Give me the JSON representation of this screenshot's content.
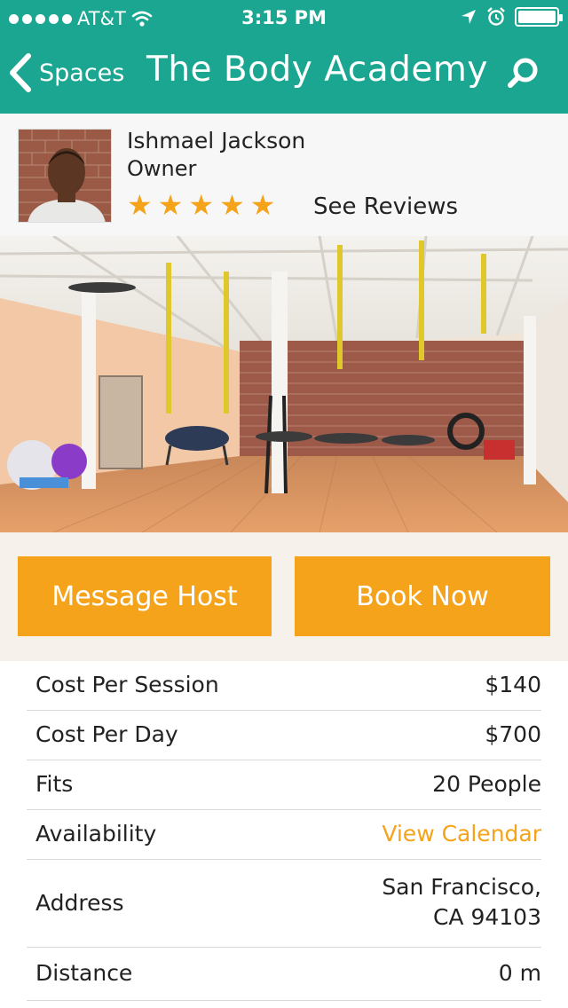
{
  "status": {
    "carrier": "AT&T",
    "time": "3:15 PM"
  },
  "nav": {
    "back_label": "Spaces",
    "title": "The Body Academy"
  },
  "host": {
    "name": "Ishmael Jackson",
    "role": "Owner",
    "rating": 5,
    "reviews_label": "See Reviews"
  },
  "actions": {
    "message_label": "Message Host",
    "book_label": "Book Now"
  },
  "details": [
    {
      "label": "Cost Per Session",
      "value": "$140"
    },
    {
      "label": "Cost Per Day",
      "value": "$700"
    },
    {
      "label": "Fits",
      "value": "20 People"
    },
    {
      "label": "Availability",
      "value": "View Calendar"
    },
    {
      "label": "Address",
      "value_line1": "San Francisco,",
      "value_line2": "CA 94103"
    },
    {
      "label": "Distance",
      "value": "0 m"
    }
  ],
  "colors": {
    "header": "#1aa690",
    "accent": "#f5a31a"
  }
}
